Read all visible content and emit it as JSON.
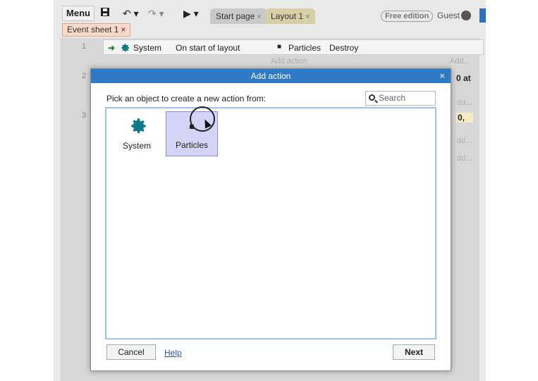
{
  "toolbar": {
    "menu_label": "Menu",
    "tabs": [
      {
        "label": "Start page",
        "close": "×"
      },
      {
        "label": "Layout 1",
        "close": "×"
      }
    ],
    "edition_badge": "Free edition",
    "user_label": "Guest"
  },
  "sheet_tab": {
    "label": "Event sheet 1",
    "close": "×"
  },
  "event_sheet": {
    "row_numbers": [
      "1",
      "2",
      "3"
    ],
    "event1": {
      "object": "System",
      "condition": "On start of layout",
      "action_object": "Particles",
      "action": "Destroy",
      "add_action": "Add action"
    },
    "faint_add": [
      "Add...",
      "dd...",
      "dd...",
      "dd..."
    ],
    "side_texts": [
      "0 at",
      "0,"
    ]
  },
  "dialog": {
    "title": "Add action",
    "close": "×",
    "prompt": "Pick an object to create a new action from:",
    "search_placeholder": "Search",
    "objects": [
      {
        "label": "System",
        "icon": "gear-icon",
        "selected": false
      },
      {
        "label": "Particles",
        "icon": "particles-icon",
        "selected": true
      }
    ],
    "cancel_label": "Cancel",
    "help_label": "Help",
    "next_label": "Next"
  },
  "colors": {
    "title_bar": "#2e7ac7",
    "selection": "#d4d4f6",
    "gear": "#0e7a86",
    "link": "#2c52c9"
  }
}
